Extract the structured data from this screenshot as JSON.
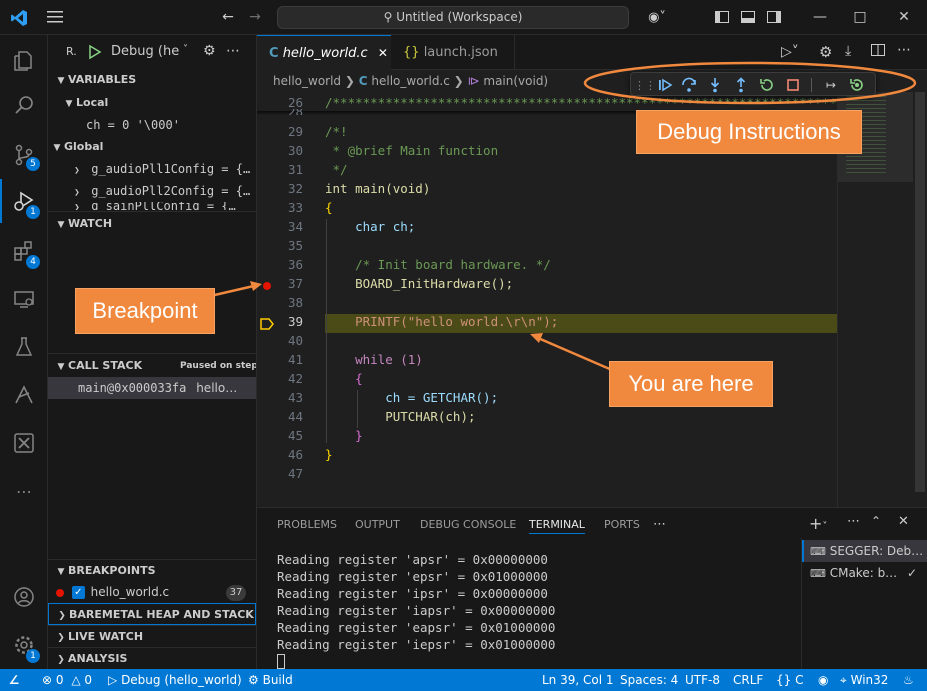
{
  "titlebar": {
    "search_text": "Untitled (Workspace)"
  },
  "activity": {
    "badges": {
      "scm": "5",
      "debug": "1",
      "extensions": "4",
      "manage": "1"
    }
  },
  "sidebar": {
    "run_label": "R.",
    "config_name": "Debug (he",
    "variables_title": "VARIABLES",
    "local_title": "Local",
    "local_var": "ch = 0 '\\000'",
    "global_title": "Global",
    "globals": [
      "g_audioPll1Config = {…",
      "g_audioPll2Config = {…",
      "g_sainPllConfig = {…"
    ],
    "watch_title": "WATCH",
    "callstack_title": "CALL STACK",
    "callstack_status": "Paused on step",
    "frame_func": "main@0x000033fa",
    "frame_file": "hello…",
    "breakpoints_title": "BREAKPOINTS",
    "bp_file": "hello_world.c",
    "bp_line": "37",
    "heap_title": "BAREMETAL HEAP AND STACK US…",
    "livewatch_title": "LIVE WATCH",
    "analysis_title": "ANALYSIS"
  },
  "editor": {
    "tabs": [
      {
        "label": "hello_world.c"
      },
      {
        "label": "launch.json"
      }
    ],
    "breadcrumbs": {
      "folder": "hello_world",
      "file": "hello_world.c",
      "symbol": "main(void)"
    },
    "lines": [
      {
        "n": "26",
        "text": "/*****************************************************************************"
      },
      {
        "n": "29",
        "text": "/*!"
      },
      {
        "n": "30",
        "text": " * @brief Main function"
      },
      {
        "n": "31",
        "text": " */"
      },
      {
        "n": "32",
        "text": "int main(void)"
      },
      {
        "n": "33",
        "text": "{"
      },
      {
        "n": "34",
        "text": "    char ch;"
      },
      {
        "n": "35",
        "text": ""
      },
      {
        "n": "36",
        "text": "    /* Init board hardware. */"
      },
      {
        "n": "37",
        "text": "    BOARD_InitHardware();"
      },
      {
        "n": "38",
        "text": ""
      },
      {
        "n": "39",
        "text": "    PRINTF(\"hello world.\\r\\n\");"
      },
      {
        "n": "40",
        "text": ""
      },
      {
        "n": "41",
        "text": "    while (1)"
      },
      {
        "n": "42",
        "text": "    {"
      },
      {
        "n": "43",
        "text": "        ch = GETCHAR();"
      },
      {
        "n": "44",
        "text": "        PUTCHAR(ch);"
      },
      {
        "n": "45",
        "text": "    }"
      },
      {
        "n": "46",
        "text": "}"
      },
      {
        "n": "47",
        "text": ""
      }
    ]
  },
  "panel": {
    "tabs": [
      "PROBLEMS",
      "OUTPUT",
      "DEBUG CONSOLE",
      "TERMINAL",
      "PORTS"
    ],
    "terminal_lines": [
      "Reading register 'apsr' = 0x00000000",
      "Reading register 'epsr' = 0x01000000",
      "Reading register 'ipsr' = 0x00000000",
      "Reading register 'iapsr' = 0x00000000",
      "Reading register 'eapsr' = 0x01000000",
      "Reading register 'iepsr' = 0x01000000"
    ],
    "terminals": [
      "SEGGER: Deb…",
      "CMake: b…"
    ]
  },
  "statusbar": {
    "errors": "0",
    "warnings": "0",
    "debug_config": "Debug (hello_world)",
    "build": "Build",
    "position": "Ln 39, Col 1",
    "spaces": "Spaces: 4",
    "encoding": "UTF-8",
    "eol": "CRLF",
    "language": "C",
    "platform": "Win32"
  },
  "annotations": {
    "debug_instructions": "Debug Instructions",
    "breakpoint": "Breakpoint",
    "you_are_here": "You are here"
  },
  "colors": {
    "accent": "#0078d4",
    "callout": "#f0883e",
    "current_line": "#4b4b18",
    "breakpoint": "#e51400"
  }
}
